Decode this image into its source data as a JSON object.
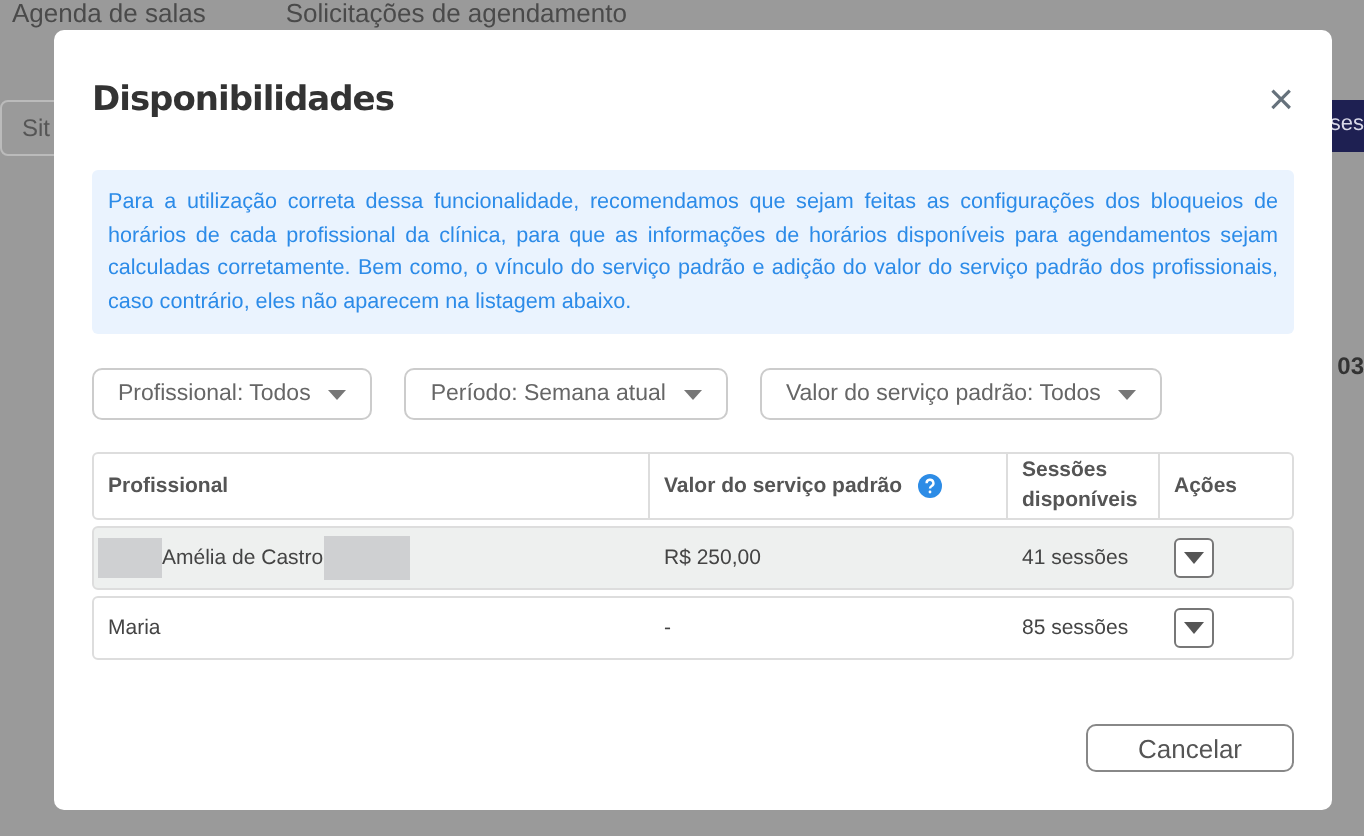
{
  "background": {
    "tabs": [
      "Agenda de salas",
      "Solicitações de agendamento"
    ],
    "left_button": "Sit",
    "right_button": "ses",
    "cell_text": "03"
  },
  "dialog": {
    "title": "Disponibilidades",
    "close": "×",
    "notice": "Para a utilização correta dessa funcionalidade, recomendamos que sejam feitas as configurações dos bloqueios de horários de cada profissional da clínica, para que as informações de horários disponíveis para agendamentos sejam calculadas corretamente. Bem como, o vínculo do serviço padrão e adição do valor do serviço padrão dos profissionais, caso contrário, eles não aparecem na listagem abaixo.",
    "filters": [
      "Profissional: Todos",
      "Período: Semana atual",
      "Valor do serviço padrão: Todos"
    ],
    "table": {
      "columns": [
        "Profissional",
        "Valor do serviço padrão",
        "Sessões disponíveis",
        "Ações"
      ],
      "rows": [
        {
          "name": "Amélia de Castro",
          "redacted": true,
          "value": "R$ 250,00",
          "sessions": "41 sessões",
          "selected": true
        },
        {
          "name": "Maria",
          "redacted": false,
          "value": "-",
          "sessions": "85 sessões",
          "selected": false
        }
      ]
    },
    "cancel": "Cancelar"
  }
}
